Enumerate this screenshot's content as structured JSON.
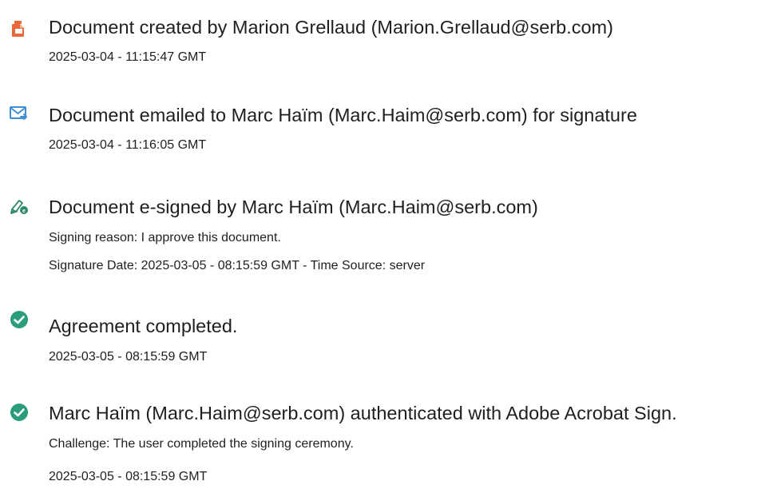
{
  "events": [
    {
      "icon": "document-created-icon",
      "title": "Document created by Marion Grellaud (Marion.Grellaud@serb.com)",
      "lines": [
        "2025-03-04 - 11:15:47 GMT"
      ]
    },
    {
      "icon": "email-sent-icon",
      "title": "Document emailed to Marc Haïm (Marc.Haim@serb.com) for signature",
      "lines": [
        "2025-03-04 - 11:16:05 GMT"
      ]
    },
    {
      "icon": "e-sign-pen-icon",
      "title": "Document e-signed by Marc Haïm (Marc.Haim@serb.com)",
      "lines": [
        "Signing reason: I approve this document.",
        "Signature Date: 2025-03-05 - 08:15:59 GMT - Time Source: server"
      ]
    },
    {
      "icon": "check-circle-icon",
      "title": "Agreement completed.",
      "lines": [
        "2025-03-05 - 08:15:59 GMT"
      ]
    },
    {
      "icon": "check-circle-icon",
      "title": "Marc Haïm (Marc.Haim@serb.com) authenticated with Adobe Acrobat Sign.",
      "lines": [
        "Challenge: The user completed the signing ceremony.",
        "2025-03-05 - 08:15:59 GMT"
      ]
    }
  ],
  "colors": {
    "created_icon": "#e8683a",
    "email_icon": "#3e8ed8",
    "sign_icon": "#2c8a6b",
    "check_icon": "#2a9d7c"
  }
}
